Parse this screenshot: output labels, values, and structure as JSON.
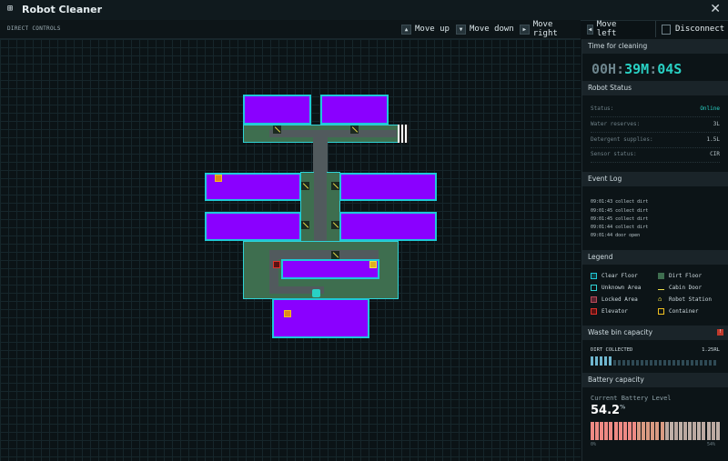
{
  "app": {
    "title": "Robot Cleaner",
    "app_icon": "grid-icon",
    "close_icon": "close-icon"
  },
  "toolbar": {
    "section_label": "DIRECT CONTROLS",
    "controls": [
      {
        "label": "Move up",
        "key": "▲"
      },
      {
        "label": "Move down",
        "key": "▼"
      },
      {
        "label": "Move right",
        "key": "▶"
      },
      {
        "label": "Move left",
        "key": "◀"
      }
    ],
    "disconnect": "Disconnect"
  },
  "sidebar": {
    "time": {
      "header": "Time for cleaning",
      "hours": "00H",
      "minutes": "39M",
      "seconds": "04S",
      "separator": ":"
    },
    "status": {
      "header": "Robot Status",
      "rows": [
        {
          "label": "Status:",
          "value": "Online"
        },
        {
          "label": "Water reserves:",
          "value": "3L"
        },
        {
          "label": "Detergent supplies:",
          "value": "1.5L"
        },
        {
          "label": "Sensor status:",
          "value": "CIR"
        }
      ]
    },
    "events": {
      "header": "Event Log",
      "items": [
        "09:01:43 collect dirt",
        "09:01:45 collect dirt",
        "09:01:45 collect dirt",
        "09:01:44 collect dirt",
        "09:01:44 door open"
      ]
    },
    "legend": {
      "header": "Legend",
      "items": [
        {
          "label": "Clear Floor",
          "color": "#1fc8d8"
        },
        {
          "label": "Dirt Floor",
          "color": "#3e6e4f"
        },
        {
          "label": "Unknown Area",
          "color": "#2fd3d6"
        },
        {
          "label": "Cabin Door",
          "color": "#f0e14a"
        },
        {
          "label": "Locked Area",
          "color": "#b84b5a"
        },
        {
          "label": "Robot Station",
          "color": "#f0e14a"
        },
        {
          "label": "Elevator",
          "color": "#e0322b"
        },
        {
          "label": "Container",
          "color": "#f0c020"
        }
      ]
    },
    "waste": {
      "header": "Waste bin capacity",
      "label": "DIRT COLLECTED",
      "value": "1.25RL"
    },
    "battery": {
      "header": "Battery capacity",
      "label": "Current Battery Level",
      "value": "54.2",
      "unit": "%",
      "level_percent": 54.2,
      "scale_min": "0%",
      "scale_max": "54%"
    }
  },
  "colors": {
    "accent": "#29d1c4",
    "room": "#8a00ff",
    "room_border": "#1fc8d8",
    "floor": "#3e6e4f",
    "corridor": "#515a5d"
  }
}
